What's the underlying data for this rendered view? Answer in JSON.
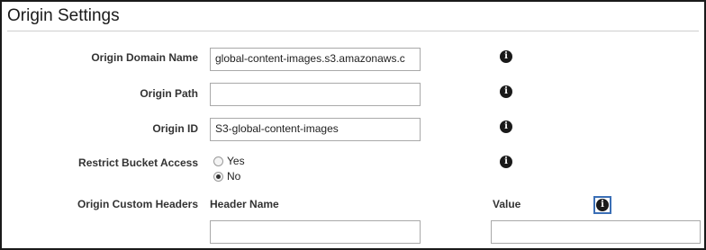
{
  "section": {
    "title": "Origin Settings"
  },
  "fields": {
    "origin_domain_name": {
      "label": "Origin Domain Name",
      "value": "global-content-images.s3.amazonaws.c",
      "info": "i"
    },
    "origin_path": {
      "label": "Origin Path",
      "value": "",
      "info": "i"
    },
    "origin_id": {
      "label": "Origin ID",
      "value": "S3-global-content-images",
      "info": "i"
    },
    "restrict_bucket_access": {
      "label": "Restrict Bucket Access",
      "options": [
        {
          "label": "Yes",
          "checked": false
        },
        {
          "label": "No",
          "checked": true
        }
      ],
      "info": "i"
    },
    "custom_headers": {
      "label": "Origin Custom Headers",
      "header_name_col": "Header Name",
      "value_col": "Value",
      "header_name_value": "",
      "value_value": "",
      "info": "i"
    }
  }
}
